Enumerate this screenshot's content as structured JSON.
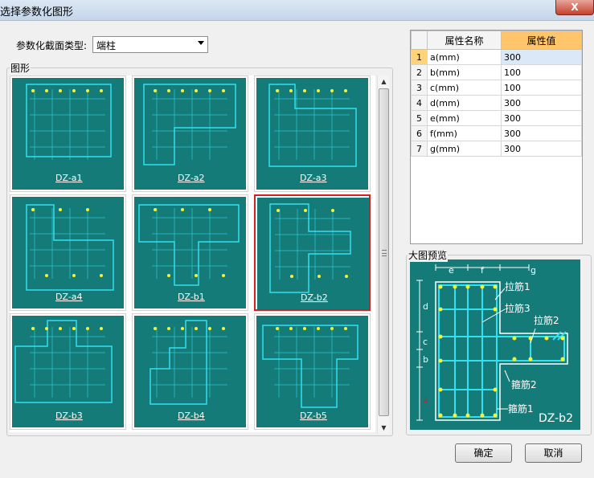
{
  "window": {
    "title": "选择参数化图形",
    "close_glyph": "X"
  },
  "section_type": {
    "label": "参数化截面类型:",
    "selected": "端柱"
  },
  "shapes_group": {
    "label": "图形",
    "thumbnails": [
      {
        "name": "DZ-a1",
        "selected": false
      },
      {
        "name": "DZ-a2",
        "selected": false
      },
      {
        "name": "DZ-a3",
        "selected": false
      },
      {
        "name": "DZ-a4",
        "selected": false
      },
      {
        "name": "DZ-b1",
        "selected": false
      },
      {
        "name": "DZ-b2",
        "selected": true
      },
      {
        "name": "DZ-b3",
        "selected": false
      },
      {
        "name": "DZ-b4",
        "selected": false
      },
      {
        "name": "DZ-b5",
        "selected": false
      }
    ]
  },
  "properties": {
    "headers": {
      "index": "",
      "name": "属性名称",
      "value": "属性值"
    },
    "rows": [
      {
        "index": "1",
        "name": "a(mm)",
        "value": "300"
      },
      {
        "index": "2",
        "name": "b(mm)",
        "value": "100"
      },
      {
        "index": "3",
        "name": "c(mm)",
        "value": "100"
      },
      {
        "index": "4",
        "name": "d(mm)",
        "value": "300"
      },
      {
        "index": "5",
        "name": "e(mm)",
        "value": "300"
      },
      {
        "index": "6",
        "name": "f(mm)",
        "value": "300"
      },
      {
        "index": "7",
        "name": "g(mm)",
        "value": "300"
      }
    ]
  },
  "preview": {
    "label": "大图预览",
    "shape_name": "DZ-b2",
    "dimension_labels": {
      "e": "e",
      "f": "f",
      "g": "g",
      "d": "d",
      "c": "c",
      "b": "b",
      "a": "a"
    },
    "annotations": [
      "拉筋1",
      "拉筋3",
      "拉筋2",
      "箍筋2",
      "箍筋1"
    ]
  },
  "buttons": {
    "ok": "确定",
    "cancel": "取消"
  },
  "colors": {
    "drawing_bg": "#157b78",
    "rebar_line": "#33e0f0",
    "rebar_dot": "#f4f435",
    "selection_border": "#d42020"
  }
}
